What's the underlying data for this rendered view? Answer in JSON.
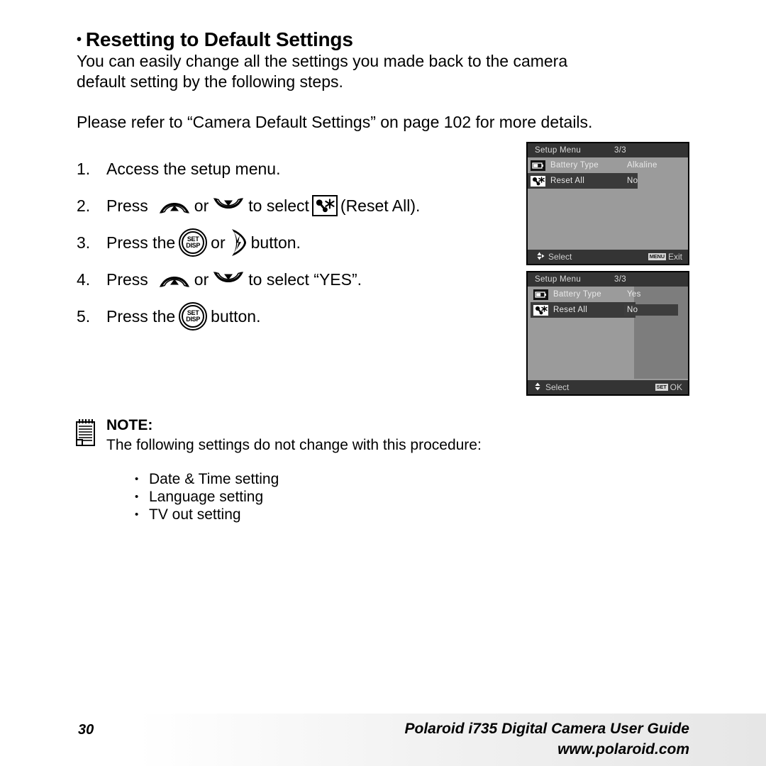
{
  "document": {
    "heading": {
      "bullet": "•",
      "text": "Resetting to Default Settings"
    },
    "intro_line1": "You can easily change all the settings you made back to the camera",
    "intro_line2": "default setting by the following steps.",
    "refer_note": "Please refer to “Camera Default Settings” on page 102 for more details.",
    "steps": [
      {
        "num": "1.",
        "text": "Access the setup menu."
      },
      {
        "num": "2.",
        "pre": "Press",
        "mid": "or",
        "post": "to select",
        "tail": "(Reset All)."
      },
      {
        "num": "3.",
        "pre": "Press the",
        "mid": "or",
        "post": "button."
      },
      {
        "num": "4.",
        "pre": "Press",
        "mid": "or",
        "post": "to select “YES”."
      },
      {
        "num": "5.",
        "pre": "Press the",
        "post": "button."
      }
    ],
    "button_labels": {
      "set": "SET",
      "disp": "DISP"
    },
    "note": {
      "title": "NOTE:",
      "text": "The following settings do not change with this procedure:",
      "bullet": "•",
      "items": [
        "Date & Time setting",
        "Language setting",
        "TV out setting"
      ]
    }
  },
  "lcd_screens": [
    {
      "id": "lcd1",
      "title": "Setup Menu",
      "page_indicator": "3/3",
      "rows": [
        {
          "icon": "battery-icon",
          "name": "Battery Type",
          "value": "Alkaline",
          "selected": false
        },
        {
          "icon": "reset-all-icon",
          "name": "Reset All",
          "value": "No",
          "selected": true
        }
      ],
      "footer_left": "Select",
      "footer_key": "MENU",
      "footer_right": "Exit"
    },
    {
      "id": "lcd2",
      "title": "Setup Menu",
      "page_indicator": "3/3",
      "rows": [
        {
          "icon": "battery-icon",
          "name": "Battery Type",
          "value": "Yes",
          "selected": false,
          "value_selected": false
        },
        {
          "icon": "reset-all-icon",
          "name": "Reset All",
          "value": "No",
          "selected": true,
          "value_selected": true
        }
      ],
      "footer_left": "Select",
      "footer_key": "SET",
      "footer_right": "OK"
    }
  ],
  "footer": {
    "page_number": "30",
    "guide_title": "Polaroid i735 Digital Camera User Guide",
    "url": "www.polaroid.com"
  },
  "colors": {
    "lcd_bar": "#343434",
    "lcd_body": "#9b9b9b",
    "lcd_value_column": "#7d7d7d",
    "lcd_highlight": "#3a3a3a",
    "text": "#000000",
    "page_background": "#ffffff"
  }
}
